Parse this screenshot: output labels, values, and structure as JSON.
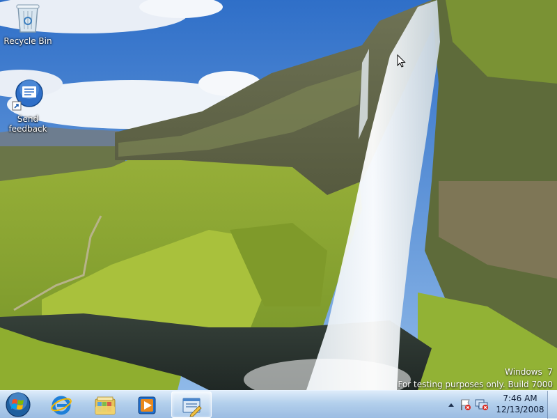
{
  "desktop": {
    "wallpaper": "waterfall-landscape",
    "icons": [
      {
        "label": "Recycle Bin",
        "icon": "recycle-bin-icon"
      },
      {
        "label": "Send\nfeedback",
        "icon": "feedback-icon"
      }
    ],
    "watermark_line1": "Windows  7",
    "watermark_line2": "For testing purposes only. Build 7000"
  },
  "taskbar": {
    "start_icon": "windows-orb-icon",
    "pinned": [
      {
        "name": "Internet Explorer",
        "icon": "internet-explorer-icon"
      },
      {
        "name": "Windows Explorer",
        "icon": "folder-library-icon"
      },
      {
        "name": "Windows Media Player",
        "icon": "media-player-icon"
      },
      {
        "name": "Send feedback",
        "icon": "feedback-window-icon",
        "active": true
      }
    ],
    "tray": {
      "icons": [
        "show-hidden-icons-arrow",
        "action-center-flag-icon",
        "network-icon"
      ],
      "time": "7:46 AM",
      "date": "12/13/2008"
    }
  },
  "colors": {
    "taskbar_top": "#dcebfa",
    "taskbar_bottom": "#96b9e1",
    "sky": "#3c7fd0"
  }
}
